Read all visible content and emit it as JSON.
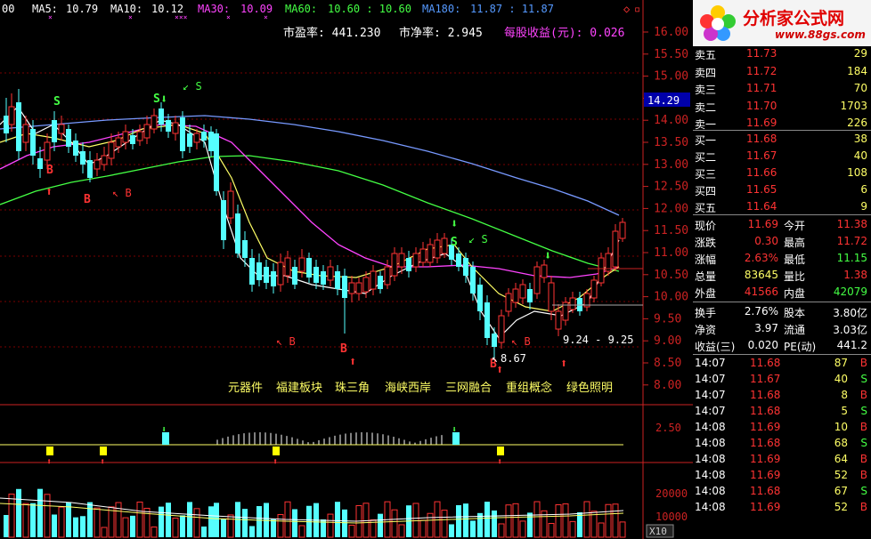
{
  "legend": {
    "prefix": "00",
    "ma5": {
      "label": "MA5:",
      "value": "10.79",
      "color": "#ffffff"
    },
    "ma10": {
      "label": "MA10:",
      "value": "10.12",
      "color": "#ffff55"
    },
    "ma30": {
      "label": "MA30:",
      "value": "10.09",
      "color": "#ff44ff"
    },
    "ma60": {
      "label": "MA60:",
      "value": "10.60 : 10.60",
      "color": "#44ff44"
    },
    "ma180": {
      "label": "MA180:",
      "value": "11.87 : 11.87",
      "color": "#5599ff"
    }
  },
  "info": {
    "pe": "市盈率: 441.230",
    "pb": "市净率: 2.945",
    "eps": "每股收益(元): 0.026"
  },
  "price_axis": [
    "16.00",
    "15.50",
    "15.00",
    "14.50",
    "14.00",
    "13.50",
    "13.00",
    "12.50",
    "12.00",
    "11.50",
    "11.00",
    "10.50",
    "10.00",
    "9.50",
    "9.00",
    "8.50",
    "8.00"
  ],
  "current_price_tag": "14.29",
  "annotations": {
    "low_label": "8.67",
    "range_label": "9.24 - 9.25",
    "signals": [
      "S",
      "S",
      "S",
      "B",
      "B",
      "B",
      "B",
      "B",
      "B"
    ]
  },
  "concepts": [
    "元器件",
    "福建板块",
    "珠三角",
    "海峡西岸",
    "三网融合",
    "重组概念",
    "绿色照明"
  ],
  "indicator_axis": "2.50",
  "volume_axis": [
    "20000",
    "10000"
  ],
  "volume_unit": "X10",
  "logo": {
    "title": "分析家公式网",
    "url": "www.88gs.com"
  },
  "sell_orders": [
    {
      "label": "卖五",
      "price": "11.73",
      "vol": "29"
    },
    {
      "label": "卖四",
      "price": "11.72",
      "vol": "184"
    },
    {
      "label": "卖三",
      "price": "11.71",
      "vol": "70"
    },
    {
      "label": "卖二",
      "price": "11.70",
      "vol": "1703"
    },
    {
      "label": "卖一",
      "price": "11.69",
      "vol": "226"
    }
  ],
  "buy_orders": [
    {
      "label": "买一",
      "price": "11.68",
      "vol": "38"
    },
    {
      "label": "买二",
      "price": "11.67",
      "vol": "40"
    },
    {
      "label": "买三",
      "price": "11.66",
      "vol": "108"
    },
    {
      "label": "买四",
      "price": "11.65",
      "vol": "6"
    },
    {
      "label": "买五",
      "price": "11.64",
      "vol": "9"
    }
  ],
  "quote": [
    {
      "l1": "现价",
      "v1": "11.69",
      "l2": "今开",
      "v2": "11.38"
    },
    {
      "l1": "涨跌",
      "v1": "0.30",
      "l2": "最高",
      "v2": "11.72"
    },
    {
      "l1": "涨幅",
      "v1": "2.63%",
      "l2": "最低",
      "v2": "11.15"
    },
    {
      "l1": "总量",
      "v1": "83645",
      "l2": "量比",
      "v2": "1.38"
    },
    {
      "l1": "外盘",
      "v1": "41566",
      "l2": "内盘",
      "v2": "42079"
    }
  ],
  "fundamentals": [
    {
      "l1": "换手",
      "v1": "2.76%",
      "l2": "股本",
      "v2": "3.80亿"
    },
    {
      "l1": "净资",
      "v1": "3.97",
      "l2": "流通",
      "v2": "3.03亿"
    },
    {
      "l1": "收益(三)",
      "v1": "0.020",
      "l2": "PE(动)",
      "v2": "441.2"
    }
  ],
  "ticks": [
    {
      "time": "14:07",
      "price": "11.68",
      "vol": "87",
      "side": "B"
    },
    {
      "time": "14:07",
      "price": "11.67",
      "vol": "40",
      "side": "S"
    },
    {
      "time": "14:07",
      "price": "11.68",
      "vol": "8",
      "side": "B"
    },
    {
      "time": "14:07",
      "price": "11.68",
      "vol": "5",
      "side": "S"
    },
    {
      "time": "14:08",
      "price": "11.69",
      "vol": "10",
      "side": "B"
    },
    {
      "time": "14:08",
      "price": "11.68",
      "vol": "68",
      "side": "S"
    },
    {
      "time": "14:08",
      "price": "11.69",
      "vol": "64",
      "side": "B"
    },
    {
      "time": "14:08",
      "price": "11.69",
      "vol": "52",
      "side": "B"
    },
    {
      "time": "14:08",
      "price": "11.68",
      "vol": "67",
      "side": "S"
    },
    {
      "time": "14:08",
      "price": "11.69",
      "vol": "52",
      "side": "B"
    }
  ],
  "colors": {
    "up": "#ff3333",
    "down": "#55ffff",
    "grid": "#7a0000",
    "axis": "#cc2222"
  }
}
